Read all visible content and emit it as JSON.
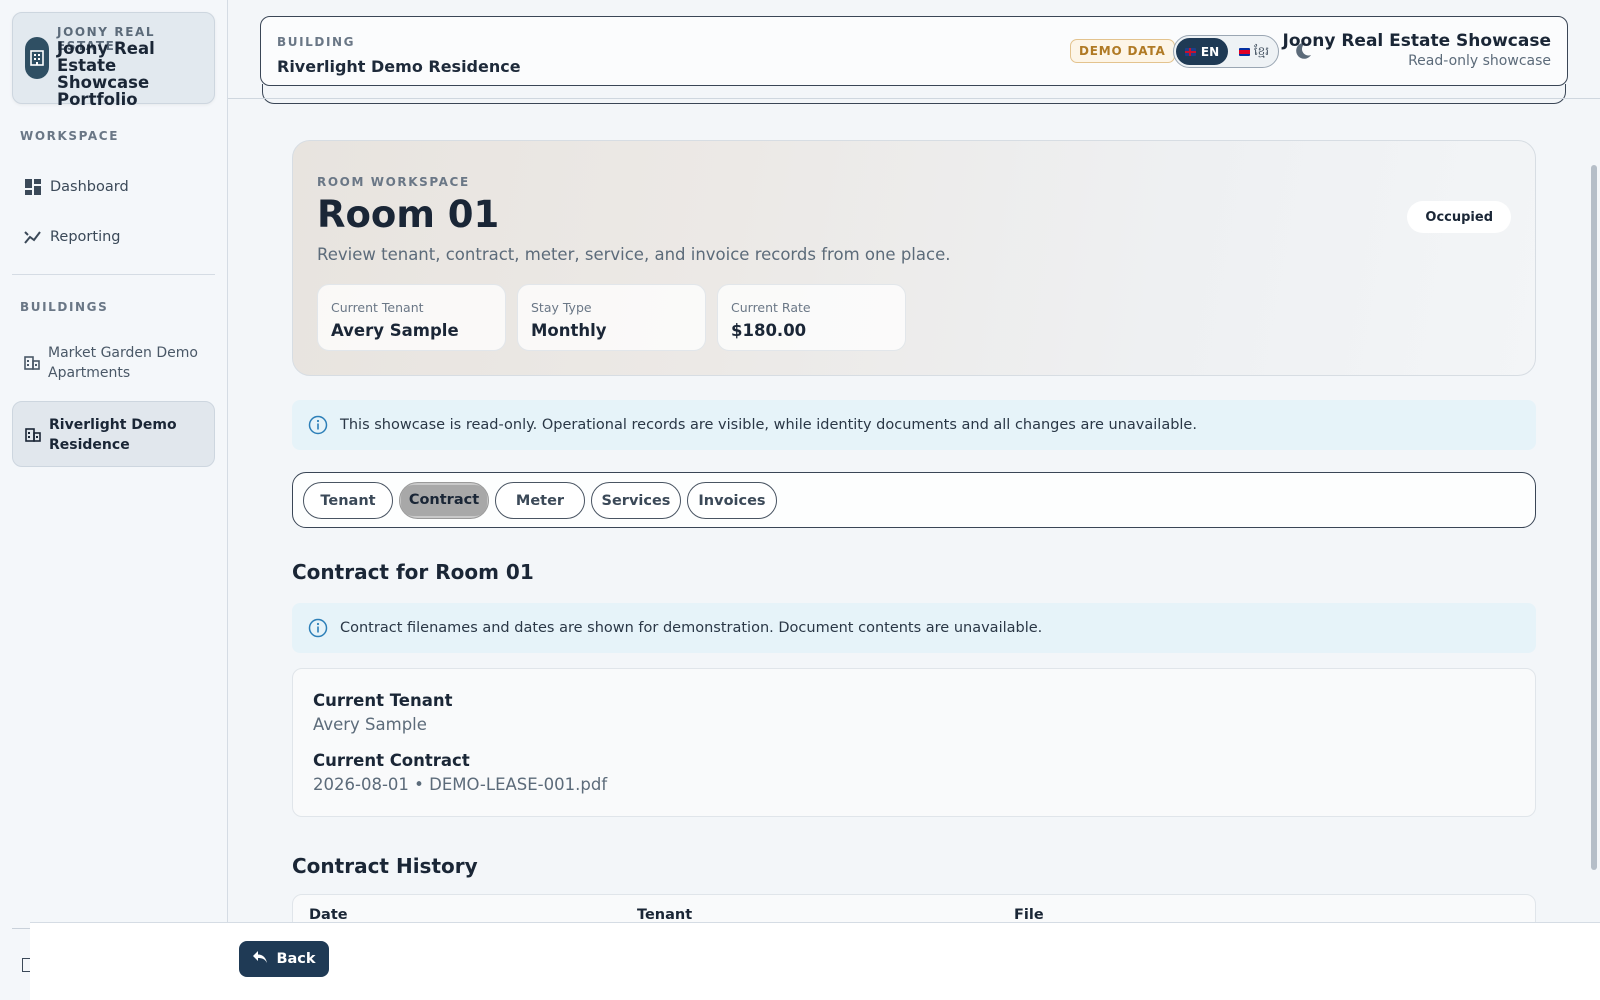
{
  "sidebar": {
    "brand": {
      "eyebrow": "JOONY REAL ESTATE",
      "title": "Joony Real Estate Showcase Portfolio"
    },
    "workspace_heading": "WORKSPACE",
    "workspace_items": [
      {
        "label": "Dashboard",
        "icon": "dashboard-icon"
      },
      {
        "label": "Reporting",
        "icon": "chart-line-icon"
      }
    ],
    "buildings_heading": "BUILDINGS",
    "buildings": [
      {
        "label": "Market Garden Demo Apartments",
        "icon": "building-icon",
        "active": false
      },
      {
        "label": "Riverlight Demo Residence",
        "icon": "building-icon",
        "active": true
      }
    ]
  },
  "header": {
    "eyebrow": "BUILDING",
    "title": "Riverlight Demo Residence",
    "demo_badge": "DEMO DATA",
    "lang_en": "EN",
    "lang_km": "ខ្មែរ",
    "showcase_title": "Joony Real Estate Showcase",
    "showcase_subtitle": "Read-only showcase"
  },
  "hero": {
    "eyebrow": "ROOM WORKSPACE",
    "title": "Room 01",
    "description": "Review tenant, contract, meter, service, and invoice records from one place.",
    "status": "Occupied",
    "stats": [
      {
        "label": "Current Tenant",
        "value": "Avery Sample"
      },
      {
        "label": "Stay Type",
        "value": "Monthly"
      },
      {
        "label": "Current Rate",
        "value": "$180.00"
      }
    ]
  },
  "notice_readonly": "This showcase is read-only. Operational records are visible, while identity documents and all changes are unavailable.",
  "tabs": [
    "Tenant",
    "Contract",
    "Meter",
    "Services",
    "Invoices"
  ],
  "active_tab": "Contract",
  "contract": {
    "title": "Contract for Room 01",
    "notice": "Contract filenames and dates are shown for demonstration. Document contents are unavailable.",
    "current_tenant_label": "Current Tenant",
    "current_tenant_value": "Avery Sample",
    "current_contract_label": "Current Contract",
    "current_contract_value": "2026-08-01 • DEMO-LEASE-001.pdf"
  },
  "history": {
    "title": "Contract History",
    "columns": [
      "Date",
      "Tenant",
      "File"
    ]
  },
  "footer": {
    "back_label": "Back"
  },
  "colors": {
    "accent": "#1f3a55",
    "alert_bg": "#e6f3f9",
    "badge": "#b07a25"
  }
}
